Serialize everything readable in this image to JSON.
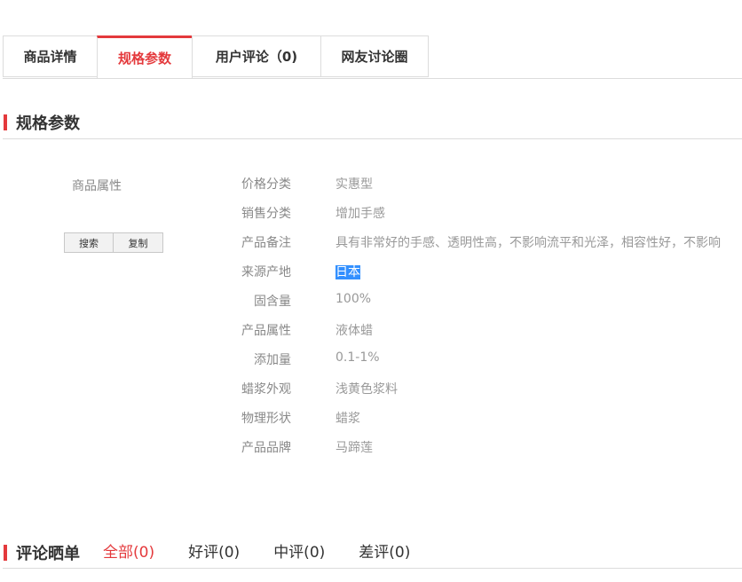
{
  "tabs": [
    {
      "label": "商品详情",
      "active": false
    },
    {
      "label": "规格参数",
      "active": true
    },
    {
      "label": "用户评论（0)",
      "active": false
    },
    {
      "label": "网友讨论圈",
      "active": false
    }
  ],
  "spec_section": {
    "title": "规格参数"
  },
  "left_panel": {
    "attr_label": "商品属性",
    "search_button": "搜索",
    "copy_button": "复制"
  },
  "specs": [
    {
      "key": "价格分类",
      "value": "实惠型"
    },
    {
      "key": "销售分类",
      "value": "增加手感"
    },
    {
      "key": "产品备注",
      "value": "具有非常好的手感、透明性高，不影响流平和光泽，相容性好，不影响"
    },
    {
      "key": "来源产地",
      "value": "日本",
      "selected": true
    },
    {
      "key": "固含量",
      "value": "100%"
    },
    {
      "key": "产品属性",
      "value": "液体蜡"
    },
    {
      "key": "添加量",
      "value": "0.1-1%"
    },
    {
      "key": "蜡浆外观",
      "value": "浅黄色浆料"
    },
    {
      "key": "物理形状",
      "value": "蜡浆"
    },
    {
      "key": "产品品牌",
      "value": "马蹄莲"
    }
  ],
  "comments": {
    "title": "评论晒单",
    "filters": [
      {
        "label": "全部(0)",
        "active": true
      },
      {
        "label": "好评(0)",
        "active": false
      },
      {
        "label": "中评(0)",
        "active": false
      },
      {
        "label": "差评(0)",
        "active": false
      }
    ]
  },
  "colors": {
    "accent": "#e4393c",
    "selection": "#3390ff"
  }
}
